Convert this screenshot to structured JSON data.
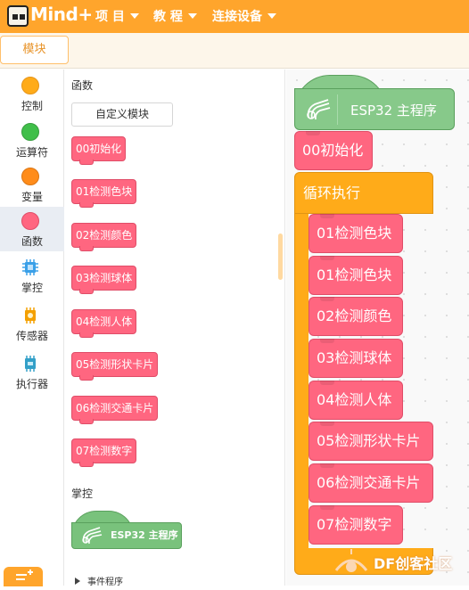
{
  "app": {
    "logo_text": "Mind+",
    "menu": [
      {
        "label": "项 目"
      },
      {
        "label": "教 程"
      },
      {
        "label": "连接设备"
      }
    ]
  },
  "tabs": [
    {
      "label": "模块",
      "active": true
    }
  ],
  "categories": [
    {
      "label": "控制",
      "color": "#ffab19",
      "icon": "circle"
    },
    {
      "label": "运算符",
      "color": "#40bf4a",
      "icon": "circle"
    },
    {
      "label": "变量",
      "color": "#ff8c1a",
      "icon": "circle"
    },
    {
      "label": "函数",
      "color": "#ff6680",
      "icon": "circle",
      "active": true
    },
    {
      "label": "掌控",
      "color": "#3aa0e8",
      "icon": "chip-icon"
    },
    {
      "label": "传感器",
      "color": "#f4a000",
      "icon": "sensor-chip-icon"
    },
    {
      "label": "执行器",
      "color": "#33a0c8",
      "icon": "actuator-chip-icon"
    }
  ],
  "palette": {
    "functions_heading": "函数",
    "custom_block_button": "自定义模块",
    "function_blocks": [
      "00初始化",
      "01检测色块",
      "02检测颜色",
      "03检测球体",
      "04检测人体",
      "05检测形状卡片",
      "06检测交通卡片",
      "07检测数字"
    ],
    "board_heading": "掌控",
    "board_hat_label": "ESP32 主程序",
    "events_label": "事件程序"
  },
  "workspace": {
    "hat_label": "ESP32 主程序",
    "init_block": "00初始化",
    "loop_label": "循环执行",
    "loop_blocks": [
      "01检测色块",
      "01检测色块",
      "02检测颜色",
      "03检测球体",
      "04检测人体",
      "05检测形状卡片",
      "06检测交通卡片",
      "07检测数字"
    ]
  },
  "watermark": {
    "text": "DF创客社区"
  },
  "colors": {
    "accent": "#ffa52c",
    "function_block": "#ff6680",
    "loop_block": "#ffab19",
    "hat_block": "#87c98a"
  }
}
